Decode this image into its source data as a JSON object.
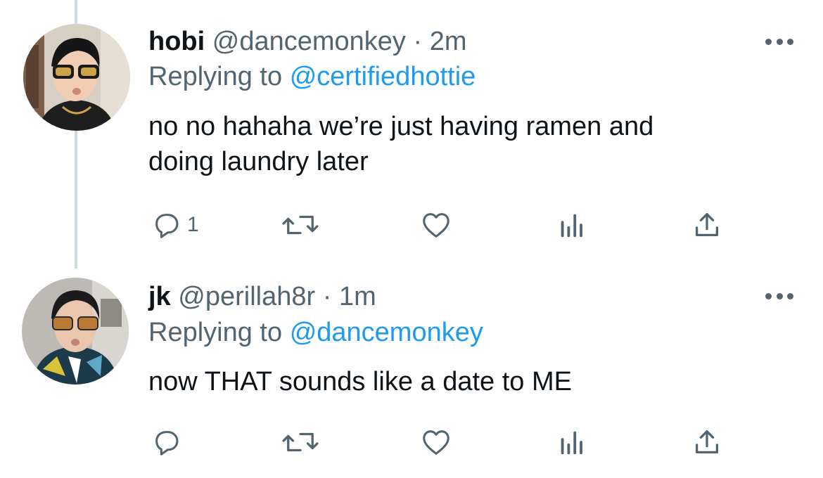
{
  "colors": {
    "text": "#0f1419",
    "secondary": "#536471",
    "link": "#1d9bf0",
    "thread_line": "#cfd9de"
  },
  "tweets": [
    {
      "display_name": "hobi",
      "handle": "@dancemonkey",
      "separator": "·",
      "time": "2m",
      "replying_prefix": "Replying to",
      "replying_to": "@certifiedhottie",
      "text_line_1": "no no hahaha we’re just having ramen and",
      "text_line_2": "doing laundry later",
      "reply_count": "1",
      "icons": [
        "more-icon",
        "reply-icon",
        "retweet-icon",
        "like-icon",
        "stats-icon",
        "share-icon"
      ]
    },
    {
      "display_name": "jk",
      "handle": "@perillah8r",
      "separator": "·",
      "time": "1m",
      "replying_prefix": "Replying to",
      "replying_to": "@dancemonkey",
      "text_line_1": "now THAT sounds like a date to ME",
      "reply_count": "",
      "icons": [
        "more-icon",
        "reply-icon",
        "retweet-icon",
        "like-icon",
        "stats-icon",
        "share-icon"
      ]
    }
  ]
}
